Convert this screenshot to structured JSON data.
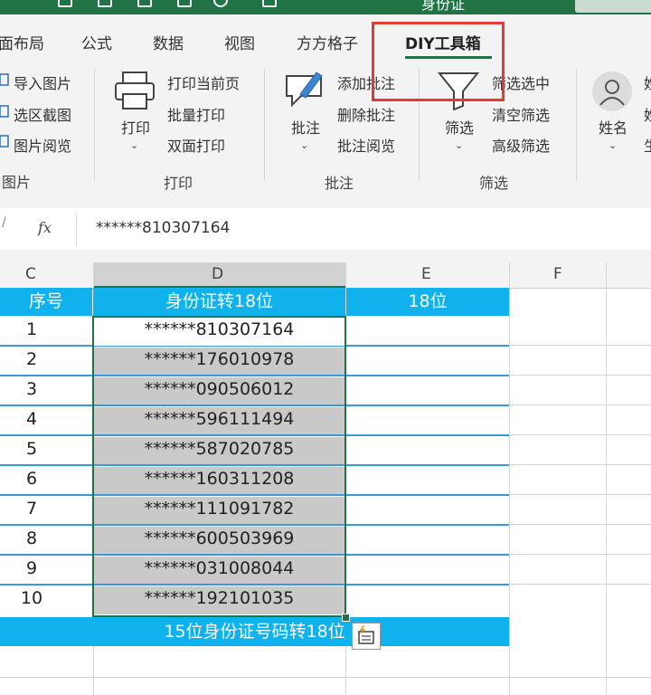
{
  "window": {
    "title": "身份证"
  },
  "tabs": [
    {
      "label": "面布局",
      "active": false
    },
    {
      "label": "公式",
      "active": false
    },
    {
      "label": "数据",
      "active": false
    },
    {
      "label": "视图",
      "active": false
    },
    {
      "label": "方方格子",
      "active": false
    },
    {
      "label": "DIY工具箱",
      "active": true
    }
  ],
  "ribbon": {
    "picture_group": {
      "items": [
        "导入图片",
        "选区截图",
        "图片阅览"
      ],
      "label": "图片"
    },
    "print_group": {
      "big_label": "打印",
      "items": [
        "打印当前页",
        "批量打印",
        "双面打印"
      ],
      "label": "打印"
    },
    "comment_group": {
      "big_label": "批注",
      "items": [
        "添加批注",
        "删除批注",
        "批注阅览"
      ],
      "label": "批注"
    },
    "filter_group": {
      "big_label": "筛选",
      "items": [
        "筛选选中",
        "清空筛选",
        "高级筛选"
      ],
      "label": "筛选"
    },
    "name_group": {
      "big_label": "姓名",
      "partial": [
        "姓",
        "姓",
        "生"
      ]
    }
  },
  "formula_bar": {
    "fx": "fx",
    "value": "******810307164"
  },
  "columns": [
    "C",
    "D",
    "E",
    "F"
  ],
  "table": {
    "headers": [
      "序号",
      "身份证转18位",
      "18位"
    ],
    "rows": [
      {
        "no": "1",
        "id": "******810307164"
      },
      {
        "no": "2",
        "id": "******176010978"
      },
      {
        "no": "3",
        "id": "******090506012"
      },
      {
        "no": "4",
        "id": "******596111494"
      },
      {
        "no": "5",
        "id": "******587020785"
      },
      {
        "no": "6",
        "id": "******160311208"
      },
      {
        "no": "7",
        "id": "******111091782"
      },
      {
        "no": "8",
        "id": "******600503969"
      },
      {
        "no": "9",
        "id": "******031008044"
      },
      {
        "no": "10",
        "id": "******192101035"
      }
    ],
    "footer": "15位身份证号码转18位"
  },
  "colors": {
    "excel_green": "#217346",
    "header_blue": "#0fb2ec",
    "highlight_red": "#e53935",
    "selected_gray": "#c9c9c9"
  }
}
